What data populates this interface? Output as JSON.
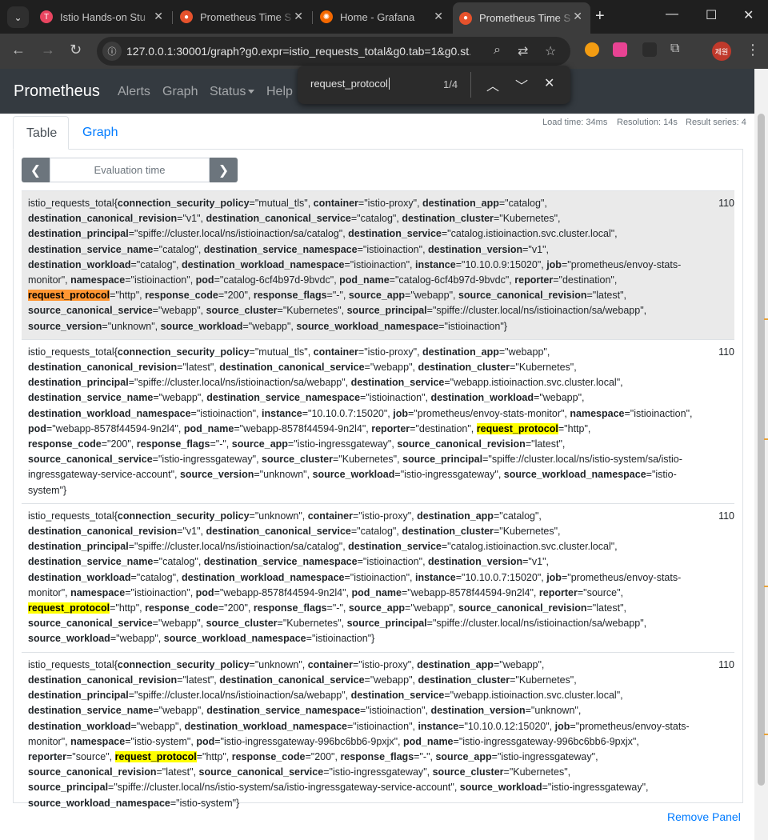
{
  "browser": {
    "tabs": [
      {
        "title": "Istio Hands-on Stu",
        "favicon": "istio-favicon",
        "active": false
      },
      {
        "title": "Prometheus Time S",
        "favicon": "prometheus-favicon",
        "active": false
      },
      {
        "title": "Home - Grafana",
        "favicon": "grafana-favicon",
        "active": false
      },
      {
        "title": "Prometheus Time S",
        "favicon": "prometheus-favicon",
        "active": true
      }
    ],
    "url": "127.0.0.1:30001/graph?g0.expr=istio_requests_total&g0.tab=1&g0.st...",
    "profile_label": "제원"
  },
  "find": {
    "query": "request_protocol",
    "count": "1/4"
  },
  "navbar": {
    "brand": "Prometheus",
    "links": [
      "Alerts",
      "Graph",
      "Status",
      "Help"
    ]
  },
  "panel": {
    "tabs": [
      "Table",
      "Graph"
    ],
    "load_time": "Load time: 34ms",
    "resolution": "Resolution: 14s",
    "result_series": "Result series: 4",
    "eval_placeholder": "Evaluation time",
    "remove_label": "Remove Panel"
  },
  "results": [
    {
      "metric": "istio_requests_total",
      "value": "110",
      "selected": true,
      "labels": [
        [
          "connection_security_policy",
          "mutual_tls"
        ],
        [
          "container",
          "istio-proxy"
        ],
        [
          "destination_app",
          "catalog"
        ],
        [
          "destination_canonical_revision",
          "v1"
        ],
        [
          "destination_canonical_service",
          "catalog"
        ],
        [
          "destination_cluster",
          "Kubernetes"
        ],
        [
          "destination_principal",
          "spiffe://cluster.local/ns/istioinaction/sa/catalog"
        ],
        [
          "destination_service",
          "catalog.istioinaction.svc.cluster.local"
        ],
        [
          "destination_service_name",
          "catalog"
        ],
        [
          "destination_service_namespace",
          "istioinaction"
        ],
        [
          "destination_version",
          "v1"
        ],
        [
          "destination_workload",
          "catalog"
        ],
        [
          "destination_workload_namespace",
          "istioinaction"
        ],
        [
          "instance",
          "10.10.0.9:15020"
        ],
        [
          "job",
          "prometheus/envoy-stats-monitor"
        ],
        [
          "namespace",
          "istioinaction"
        ],
        [
          "pod",
          "catalog-6cf4b97d-9bvdc"
        ],
        [
          "pod_name",
          "catalog-6cf4b97d-9bvdc"
        ],
        [
          "reporter",
          "destination"
        ],
        [
          "request_protocol",
          "http"
        ],
        [
          "response_code",
          "200"
        ],
        [
          "response_flags",
          "-"
        ],
        [
          "source_app",
          "webapp"
        ],
        [
          "source_canonical_revision",
          "latest"
        ],
        [
          "source_canonical_service",
          "webapp"
        ],
        [
          "source_cluster",
          "Kubernetes"
        ],
        [
          "source_principal",
          "spiffe://cluster.local/ns/istioinaction/sa/webapp"
        ],
        [
          "source_version",
          "unknown"
        ],
        [
          "source_workload",
          "webapp"
        ],
        [
          "source_workload_namespace",
          "istioinaction"
        ]
      ]
    },
    {
      "metric": "istio_requests_total",
      "value": "110",
      "selected": false,
      "labels": [
        [
          "connection_security_policy",
          "mutual_tls"
        ],
        [
          "container",
          "istio-proxy"
        ],
        [
          "destination_app",
          "webapp"
        ],
        [
          "destination_canonical_revision",
          "latest"
        ],
        [
          "destination_canonical_service",
          "webapp"
        ],
        [
          "destination_cluster",
          "Kubernetes"
        ],
        [
          "destination_principal",
          "spiffe://cluster.local/ns/istioinaction/sa/webapp"
        ],
        [
          "destination_service",
          "webapp.istioinaction.svc.cluster.local"
        ],
        [
          "destination_service_name",
          "webapp"
        ],
        [
          "destination_service_namespace",
          "istioinaction"
        ],
        [
          "destination_workload",
          "webapp"
        ],
        [
          "destination_workload_namespace",
          "istioinaction"
        ],
        [
          "instance",
          "10.10.0.7:15020"
        ],
        [
          "job",
          "prometheus/envoy-stats-monitor"
        ],
        [
          "namespace",
          "istioinaction"
        ],
        [
          "pod",
          "webapp-8578f44594-9n2l4"
        ],
        [
          "pod_name",
          "webapp-8578f44594-9n2l4"
        ],
        [
          "reporter",
          "destination"
        ],
        [
          "request_protocol",
          "http"
        ],
        [
          "response_code",
          "200"
        ],
        [
          "response_flags",
          "-"
        ],
        [
          "source_app",
          "istio-ingressgateway"
        ],
        [
          "source_canonical_revision",
          "latest"
        ],
        [
          "source_canonical_service",
          "istio-ingressgateway"
        ],
        [
          "source_cluster",
          "Kubernetes"
        ],
        [
          "source_principal",
          "spiffe://cluster.local/ns/istio-system/sa/istio-ingressgateway-service-account"
        ],
        [
          "source_version",
          "unknown"
        ],
        [
          "source_workload",
          "istio-ingressgateway"
        ],
        [
          "source_workload_namespace",
          "istio-system"
        ]
      ]
    },
    {
      "metric": "istio_requests_total",
      "value": "110",
      "selected": false,
      "labels": [
        [
          "connection_security_policy",
          "unknown"
        ],
        [
          "container",
          "istio-proxy"
        ],
        [
          "destination_app",
          "catalog"
        ],
        [
          "destination_canonical_revision",
          "v1"
        ],
        [
          "destination_canonical_service",
          "catalog"
        ],
        [
          "destination_cluster",
          "Kubernetes"
        ],
        [
          "destination_principal",
          "spiffe://cluster.local/ns/istioinaction/sa/catalog"
        ],
        [
          "destination_service",
          "catalog.istioinaction.svc.cluster.local"
        ],
        [
          "destination_service_name",
          "catalog"
        ],
        [
          "destination_service_namespace",
          "istioinaction"
        ],
        [
          "destination_version",
          "v1"
        ],
        [
          "destination_workload",
          "catalog"
        ],
        [
          "destination_workload_namespace",
          "istioinaction"
        ],
        [
          "instance",
          "10.10.0.7:15020"
        ],
        [
          "job",
          "prometheus/envoy-stats-monitor"
        ],
        [
          "namespace",
          "istioinaction"
        ],
        [
          "pod",
          "webapp-8578f44594-9n2l4"
        ],
        [
          "pod_name",
          "webapp-8578f44594-9n2l4"
        ],
        [
          "reporter",
          "source"
        ],
        [
          "request_protocol",
          "http"
        ],
        [
          "response_code",
          "200"
        ],
        [
          "response_flags",
          "-"
        ],
        [
          "source_app",
          "webapp"
        ],
        [
          "source_canonical_revision",
          "latest"
        ],
        [
          "source_canonical_service",
          "webapp"
        ],
        [
          "source_cluster",
          "Kubernetes"
        ],
        [
          "source_principal",
          "spiffe://cluster.local/ns/istioinaction/sa/webapp"
        ],
        [
          "source_workload",
          "webapp"
        ],
        [
          "source_workload_namespace",
          "istioinaction"
        ]
      ]
    },
    {
      "metric": "istio_requests_total",
      "value": "110",
      "selected": false,
      "labels": [
        [
          "connection_security_policy",
          "unknown"
        ],
        [
          "container",
          "istio-proxy"
        ],
        [
          "destination_app",
          "webapp"
        ],
        [
          "destination_canonical_revision",
          "latest"
        ],
        [
          "destination_canonical_service",
          "webapp"
        ],
        [
          "destination_cluster",
          "Kubernetes"
        ],
        [
          "destination_principal",
          "spiffe://cluster.local/ns/istioinaction/sa/webapp"
        ],
        [
          "destination_service",
          "webapp.istioinaction.svc.cluster.local"
        ],
        [
          "destination_service_name",
          "webapp"
        ],
        [
          "destination_service_namespace",
          "istioinaction"
        ],
        [
          "destination_version",
          "unknown"
        ],
        [
          "destination_workload",
          "webapp"
        ],
        [
          "destination_workload_namespace",
          "istioinaction"
        ],
        [
          "instance",
          "10.10.0.12:15020"
        ],
        [
          "job",
          "prometheus/envoy-stats-monitor"
        ],
        [
          "namespace",
          "istio-system"
        ],
        [
          "pod",
          "istio-ingressgateway-996bc6bb6-9pxjx"
        ],
        [
          "pod_name",
          "istio-ingressgateway-996bc6bb6-9pxjx"
        ],
        [
          "reporter",
          "source"
        ],
        [
          "request_protocol",
          "http"
        ],
        [
          "response_code",
          "200"
        ],
        [
          "response_flags",
          "-"
        ],
        [
          "source_app",
          "istio-ingressgateway"
        ],
        [
          "source_canonical_revision",
          "latest"
        ],
        [
          "source_canonical_service",
          "istio-ingressgateway"
        ],
        [
          "source_cluster",
          "Kubernetes"
        ],
        [
          "source_principal",
          "spiffe://cluster.local/ns/istio-system/sa/istio-ingressgateway-service-account"
        ],
        [
          "source_workload",
          "istio-ingressgateway"
        ],
        [
          "source_workload_namespace",
          "istio-system"
        ]
      ]
    }
  ],
  "colors": {
    "highlight": "#ffff00",
    "highlight_current": "#ff9632",
    "link": "#007bff",
    "navbar": "#343a40"
  }
}
